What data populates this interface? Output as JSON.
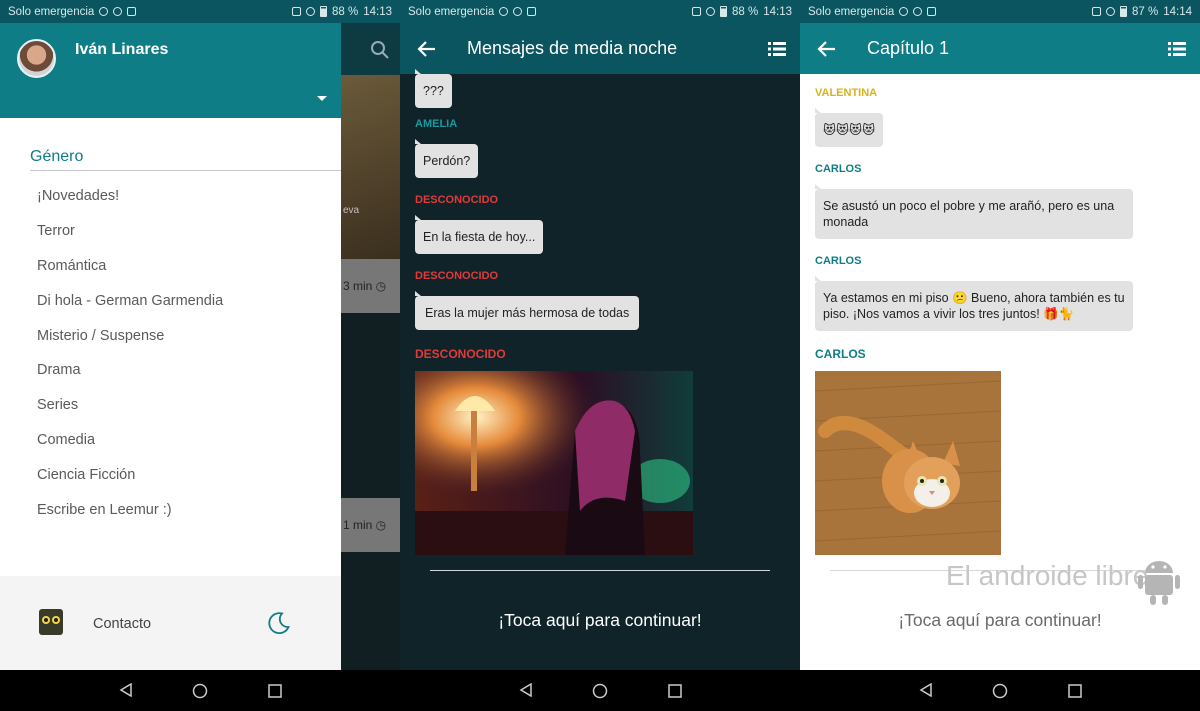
{
  "status": {
    "carrier": "Solo emergencia",
    "screens": [
      {
        "battery": "88 %",
        "time": "14:13"
      },
      {
        "battery": "88 %",
        "time": "14:13"
      },
      {
        "battery": "87 %",
        "time": "14:14"
      }
    ]
  },
  "drawer": {
    "user_name": "Iván Linares",
    "section_title": "Género",
    "items": [
      "¡Novedades!",
      "Terror",
      "Romántica",
      "Di hola - German Garmendia",
      "Misterio / Suspense",
      "Drama",
      "Series",
      "Comedia",
      "Ciencia Ficción",
      "Escribe en Leemur :)"
    ],
    "contact_label": "Contacto",
    "peek_card_1": "3 min",
    "peek_card_2": "1 min",
    "peek_text": "eva"
  },
  "chat1": {
    "title": "Mensajes de media noche",
    "messages": [
      {
        "text": "???"
      },
      {
        "sender": "AMELIA",
        "text": "Perdón?"
      },
      {
        "sender": "DESCONOCIDO",
        "text": "En la fiesta de hoy..."
      },
      {
        "sender": "DESCONOCIDO",
        "text": "Eras la mujer más hermosa de todas"
      },
      {
        "sender": "DESCONOCIDO"
      }
    ],
    "continue_label": "¡Toca aquí para continuar!"
  },
  "chat2": {
    "title": "Capítulo 1",
    "messages": [
      {
        "sender": "VALENTINA",
        "text": "😻😻😻😻"
      },
      {
        "sender": "CARLOS",
        "text": "Se asustó un poco el pobre y me arañó, pero es una monada"
      },
      {
        "sender": "CARLOS",
        "text": "Ya estamos en mi piso 😕 Bueno, ahora también es tu piso. ¡Nos vamos a vivir los tres juntos! 🎁🐈"
      },
      {
        "sender": "CARLOS"
      }
    ],
    "continue_label": "¡Toca aquí para continuar!",
    "watermark": "El androide libre"
  },
  "colors": {
    "teal": "#0f7d86",
    "dark_teal": "#0a5560",
    "red": "#e23a3a",
    "gold": "#d8b21a"
  }
}
